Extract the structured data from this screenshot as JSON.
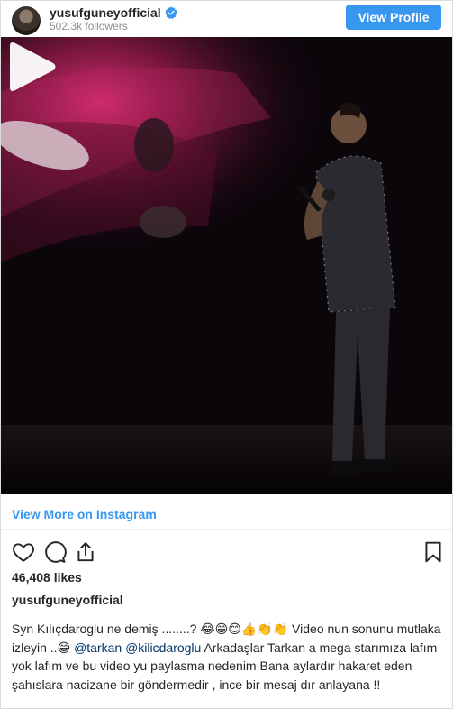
{
  "header": {
    "username": "yusufguneyofficial",
    "followers": "502.3k followers",
    "view_profile_label": "View Profile",
    "verified_color": "#3897f0"
  },
  "media": {
    "type": "video",
    "play_icon": "play-icon"
  },
  "view_more_label": "View More on Instagram",
  "actions": {
    "icons": [
      "heart-icon",
      "comment-icon",
      "share-icon",
      "bookmark-icon"
    ]
  },
  "likes": "46,408 likes",
  "post_username": "yusufguneyofficial",
  "caption": {
    "part1": "Syn Kılıçdaroglu ne demiş ........? 😂😁😊👍👏👏 Video nun sonunu mutlaka izleyin ..😁 ",
    "mention1": "@tarkan",
    "space": " ",
    "mention2": "@kilicdaroglu",
    "part2": " Arkadaşlar Tarkan a mega starımıza lafım yok lafım ve bu video yu paylasma nedenim Bana aylardır hakaret eden şahıslara nacizane bir göndermedir , ince bir mesaj dır anlayana !!"
  },
  "colors": {
    "accent": "#3897f0",
    "mention": "#00376b",
    "muted": "#8e8e8e"
  }
}
